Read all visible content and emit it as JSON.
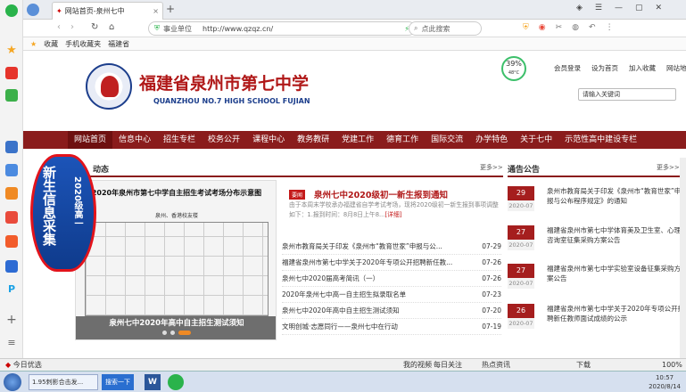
{
  "browser": {
    "tab_title": "网站首页-泉州七中",
    "security_label": "事业单位",
    "url": "http://www.qzqz.cn/",
    "search_placeholder": "点此搜索",
    "favorites": [
      "收藏",
      "手机收藏夹",
      "福建省"
    ],
    "new_tab": "+"
  },
  "site": {
    "school_name_cn": "福建省泉州市第七中学",
    "school_name_en": "QUANZHOU NO.7 HIGH SCHOOL FUJIAN",
    "top_links": [
      "会员登录",
      "设为首页",
      "加入收藏",
      "网站地"
    ],
    "search_placeholder": "请输入关键词",
    "weather_pct": "39%",
    "weather_temp": "48°C"
  },
  "nav": [
    "网站首页",
    "信息中心",
    "招生专栏",
    "校务公开",
    "课程中心",
    "教务教研",
    "党建工作",
    "德育工作",
    "国际交流",
    "办学特色",
    "关于七中",
    "示范性高中建设专栏"
  ],
  "banner": {
    "big": "新生信息采集",
    "small": "2020级高一"
  },
  "news": {
    "section_title": "动态",
    "more": "更多>>",
    "slide_title": "2020年泉州市第七中学自主招生考试考场分布示意图",
    "slide_sub": "泉州、香港校友楼",
    "slide_caption": "泉州七中2020年高中自主招生测试须知",
    "headline_tag": "要闻",
    "headline": "泉州七中2020级初一新生报到通知",
    "summary": "由于本周末学校承办福建省自学考试考场，现将2020级初一新生报到事项调整如下：1.报到时间：8月8日上午8...",
    "detail": "[详细]",
    "items": [
      {
        "title": "泉州市教育局关于印发《泉州市“教育世家”申报与公...",
        "date": "07-29"
      },
      {
        "title": "福建省泉州市第七中学关于2020年专项公开招聘新任教...",
        "date": "07-26"
      },
      {
        "title": "泉州七中2020届高考简讯（一）",
        "date": "07-26"
      },
      {
        "title": "2020年泉州七中高一自主招生拟录取名单",
        "date": "07-23"
      },
      {
        "title": "泉州七中2020年高中自主招生测试须知",
        "date": "07-20"
      },
      {
        "title": "文明创城·志愿同行——泉州七中在行动",
        "date": "07-19"
      }
    ]
  },
  "notices": {
    "section_title": "通告公告",
    "more": "更多>>",
    "items": [
      {
        "day": "29",
        "year": "2020-07",
        "text": "泉州市教育局关于印发《泉州市“教育世家”申报与公布程序规定》的通知"
      },
      {
        "day": "27",
        "year": "2020-07",
        "text": "福建省泉州市第七中学体育美及卫生室、心理咨询室征集采购方案公告"
      },
      {
        "day": "27",
        "year": "2020-07",
        "text": "福建省泉州市第七中学实验室设备征集采购方案公告"
      },
      {
        "day": "26",
        "year": "2020-07",
        "text": "福建省泉州市第七中学关于2020年专项公开招聘新任教师面试成绩的公示"
      }
    ]
  },
  "statusbar": {
    "left": "今日优选",
    "items": [
      "我的视频",
      "每日关注",
      "热点资讯",
      "下载"
    ],
    "zoom": "100%"
  },
  "taskbar": {
    "item1": "1.95刺影合击发...",
    "item2": "搜索一下",
    "time": "10:57",
    "date": "2020/8/14"
  }
}
